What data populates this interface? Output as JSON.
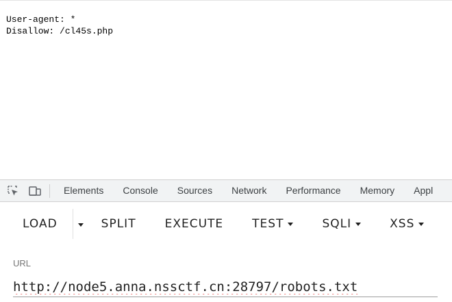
{
  "page": {
    "robots_lines": "User-agent: *\nDisallow: /cl45s.php"
  },
  "devtools": {
    "icons": [
      "inspect-element-icon",
      "device-toolbar-icon"
    ],
    "tabs": [
      "Elements",
      "Console",
      "Sources",
      "Network",
      "Performance",
      "Memory",
      "Appl"
    ]
  },
  "hackbar": {
    "load_label": "LOAD",
    "split_label": "SPLIT",
    "execute_label": "EXECUTE",
    "test_label": "TEST",
    "sqli_label": "SQLI",
    "xss_label": "XSS"
  },
  "url": {
    "label": "URL",
    "value": "http://node5.anna.nssctf.cn:28797/robots.txt"
  },
  "colors": {
    "devtools_bg": "#f1f3f4",
    "spellcheck_underline": "#e53935",
    "label_gray": "#757575"
  }
}
